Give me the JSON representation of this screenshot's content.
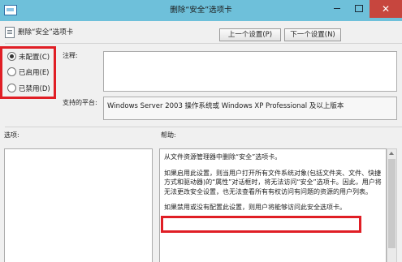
{
  "window": {
    "title": "删除“安全”选项卡",
    "close_glyph": "✕"
  },
  "header": {
    "policy_title": "删除“安全”选项卡",
    "prev_button": "上一个设置(P)",
    "next_button": "下一个设置(N)"
  },
  "state": {
    "options": [
      {
        "label": "未配置(C)",
        "selected": true
      },
      {
        "label": "已启用(E)",
        "selected": false
      },
      {
        "label": "已禁用(D)",
        "selected": false
      }
    ]
  },
  "comment": {
    "label": "注释:",
    "value": ""
  },
  "platform": {
    "label": "支持的平台:",
    "value": "Windows Server 2003 操作系统或 Windows XP Professional 及以上版本"
  },
  "options_label": "选项:",
  "help": {
    "label": "帮助:",
    "paragraphs": [
      "从文件资源管理器中删除“安全”选项卡。",
      "如果启用此设置，则当用户打开所有文件系统对象(包括文件夹、文件、快捷方式和驱动器)的“属性”对话框时，将无法访问“安全”选项卡。因此，用户将无法更改安全设置，也无法查看所有有权访问有问题的资源的用户列表。",
      "如果禁用或没有配置此设置，则用户将能够访问此安全选项卡。"
    ]
  },
  "colors": {
    "highlight": "#e01e25",
    "titlebar": "#6ec0da",
    "close_button": "#c7463e"
  }
}
